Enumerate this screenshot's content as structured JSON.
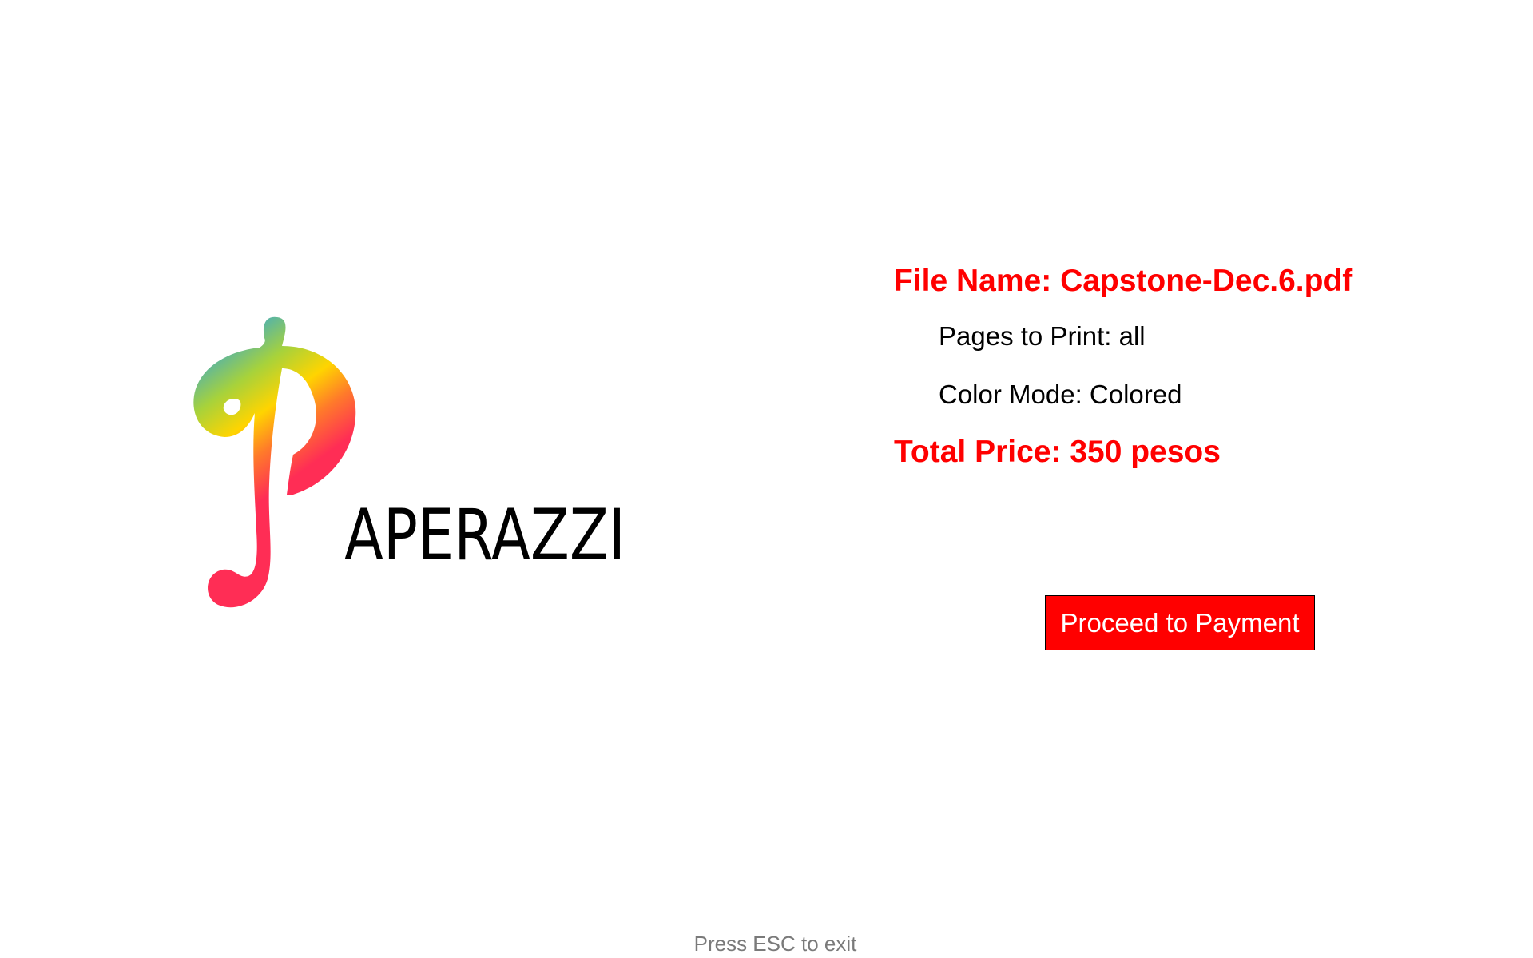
{
  "logo": {
    "text": "APERAZZI",
    "gradient_colors": [
      "#1f9ff0",
      "#a7d23b",
      "#ffd400",
      "#ff7a2a",
      "#ff2d55"
    ],
    "text_color": "#000000"
  },
  "summary": {
    "file_name": "File Name: Capstone-Dec.6.pdf",
    "pages_to_print": "Pages to Print: all",
    "color_mode": "Color Mode: Colored",
    "total_price": "Total Price: 350 pesos"
  },
  "actions": {
    "proceed_label": "Proceed to Payment"
  },
  "footer": {
    "hint": "Press ESC to exit"
  },
  "colors": {
    "accent": "#ff0000",
    "hint": "#7a7a7a"
  }
}
